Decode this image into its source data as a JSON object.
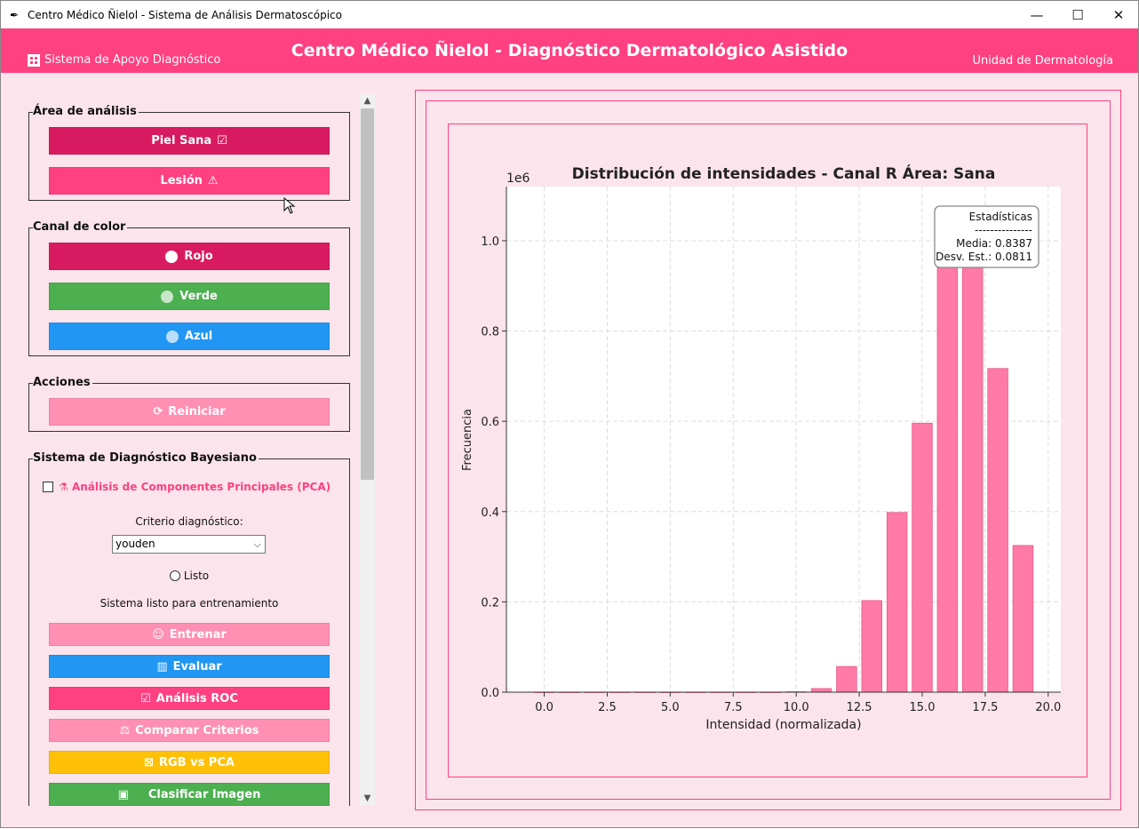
{
  "window": {
    "title": "Centro Médico Ñielol - Sistema de Análisis Dermatoscópico",
    "minimize": "—",
    "maximize": "☐",
    "close": "✕"
  },
  "header": {
    "left_label": "Sistema de Apoyo Diagnóstico",
    "title": "Centro Médico Ñielol - Diagnóstico Dermatológico Asistido",
    "right_label": "Unidad de Dermatología"
  },
  "area_group": {
    "title": "Área de análisis",
    "healthy_label": "Piel Sana",
    "healthy_icon": "☑",
    "lesion_label": "Lesión",
    "lesion_icon": "⚠"
  },
  "channel_group": {
    "title": "Canal de color",
    "red_label": "Rojo",
    "green_label": "Verde",
    "blue_label": "Azul"
  },
  "actions_group": {
    "title": "Acciones",
    "reset_label": "Reiniciar",
    "reset_icon": "⟳"
  },
  "bayes_group": {
    "title": "Sistema de Diagnóstico Bayesiano",
    "pca_label": "Análisis de Componentes Principales (PCA)",
    "criterion_label": "Criterio diagnóstico:",
    "criterion_value": "youden",
    "ready_radio_label": "Listo",
    "status_text": "Sistema listo para entrenamiento",
    "train_label": "Entrenar",
    "evaluate_label": "Evaluar",
    "roc_label": "Análisis ROC",
    "compare_label": "Comparar Criterios",
    "rgb_pca_label": "RGB vs PCA",
    "classify_label": "Clasificar Imagen"
  },
  "colors": {
    "accent": "#ff4081",
    "dark_pink": "#d81b60",
    "light_pink": "#ff8fb3",
    "green": "#4caf50",
    "blue": "#2196f3",
    "amber": "#ffc107",
    "bar_fill": "#ff7aa6",
    "bar_edge": "#e85a8c"
  },
  "chart_data": {
    "type": "bar",
    "title": "Distribución de intensidades - Canal R Área: Sana",
    "xlabel": "Intensidad (normalizada)",
    "ylabel": "Frecuencia",
    "y_multiplier": "1e6",
    "xlim": [
      -1.5,
      20.5
    ],
    "ylim": [
      0,
      1.12
    ],
    "xticks": [
      0.0,
      2.5,
      5.0,
      7.5,
      10.0,
      12.5,
      15.0,
      17.5,
      20.0
    ],
    "yticks": [
      0.0,
      0.2,
      0.4,
      0.6,
      0.8,
      1.0
    ],
    "grid": true,
    "x": [
      0,
      1,
      2,
      3,
      4,
      5,
      6,
      7,
      8,
      9,
      10,
      11,
      12,
      13,
      14,
      15,
      16,
      17,
      18,
      19
    ],
    "values": [
      0,
      0,
      0,
      0,
      0,
      0,
      0,
      0,
      0,
      0,
      0.001,
      0.008,
      0.057,
      0.203,
      0.398,
      0.596,
      0.983,
      1.01,
      0.717,
      0.325
    ],
    "annotation": {
      "position": "top-right",
      "lines": [
        "Estadísticas",
        "---------------",
        "Media: 0.8387",
        "Desv. Est.: 0.0811"
      ]
    }
  }
}
